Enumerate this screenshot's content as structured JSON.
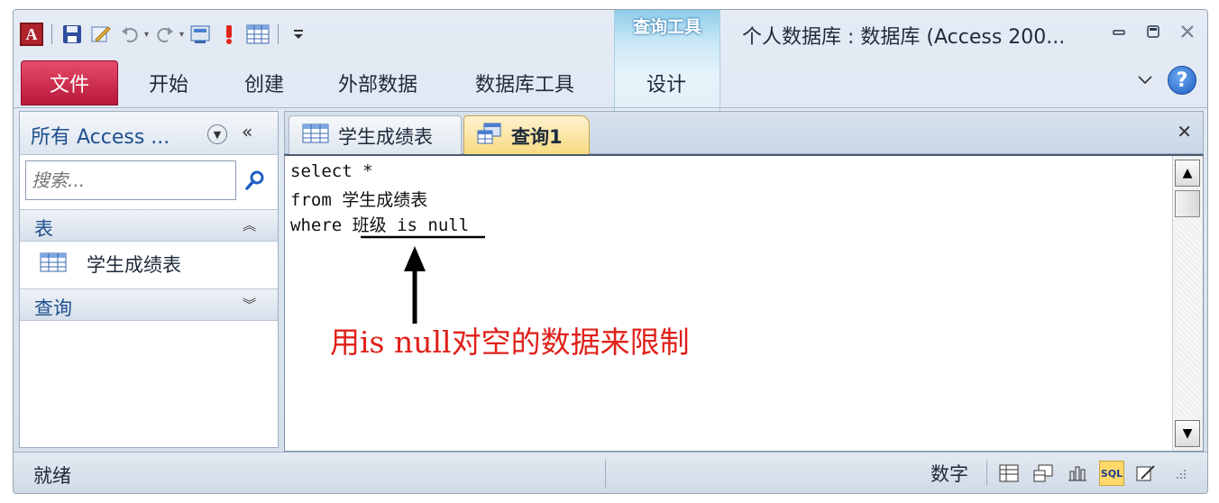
{
  "app": {
    "window_title": "个人数据库 : 数据库 (Access 200...",
    "context_tab_group": "查询工具"
  },
  "ribbon": {
    "file_tab": "文件",
    "tabs": [
      "开始",
      "创建",
      "外部数据",
      "数据库工具",
      "设计"
    ]
  },
  "nav": {
    "title": "所有 Access ...",
    "search_placeholder": "搜索...",
    "groups": [
      {
        "label": "表",
        "items": [
          "学生成绩表"
        ]
      },
      {
        "label": "查询",
        "items": []
      }
    ]
  },
  "doc_tabs": [
    {
      "label": "学生成绩表",
      "active": false
    },
    {
      "label": "查询1",
      "active": true
    }
  ],
  "sql": {
    "lines": [
      "select *",
      "from 学生成绩表",
      "where 班级 is null"
    ]
  },
  "annotation": "用is null对空的数据来限制",
  "status": {
    "left": "就绪",
    "mode": "数字"
  },
  "colors": {
    "file_tab": "#c8203f",
    "annotation": "#e0201a",
    "active_tab": "#f7d97f"
  }
}
